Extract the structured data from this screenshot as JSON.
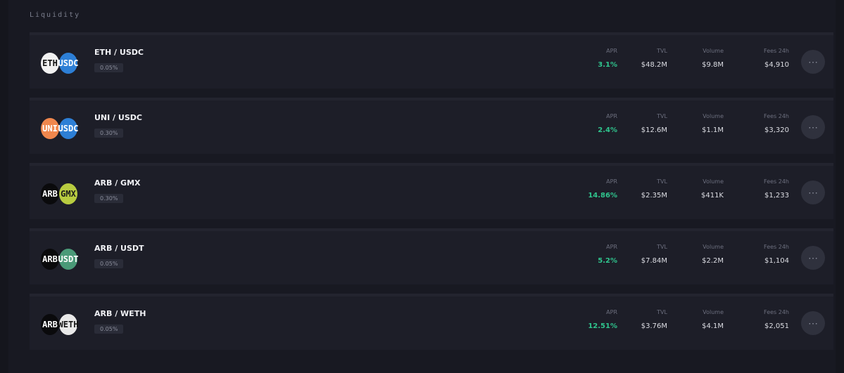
{
  "section": {
    "title": "Liquidity"
  },
  "pools": [
    {
      "name": "ETH / USDC",
      "badge": "0.05%",
      "token_a": {
        "symbol": "ETH",
        "icon": "eth-icon",
        "color": "#f2f2f2",
        "text": "#141414"
      },
      "token_b": {
        "symbol": "USDC",
        "icon": "usdc-icon",
        "color": "#2d7fd6",
        "text": "#ffffff"
      },
      "apr": {
        "label": "APR",
        "value": "3.1%"
      },
      "tvl": {
        "label": "TVL",
        "value": "$48.2M"
      },
      "volume": {
        "label": "Volume",
        "value": "$9.8M"
      },
      "fees": {
        "label": "Fees 24h",
        "value": "$4,910"
      }
    },
    {
      "name": "UNI / USDC",
      "badge": "0.30%",
      "token_a": {
        "symbol": "UNI",
        "icon": "uni-icon",
        "color": "#f0874d",
        "text": "#ffffff"
      },
      "token_b": {
        "symbol": "USDC",
        "icon": "usdc-icon",
        "color": "#2d7fd6",
        "text": "#ffffff"
      },
      "apr": {
        "label": "APR",
        "value": "2.4%"
      },
      "tvl": {
        "label": "TVL",
        "value": "$12.6M"
      },
      "volume": {
        "label": "Volume",
        "value": "$1.1M"
      },
      "fees": {
        "label": "Fees 24h",
        "value": "$3,320"
      }
    },
    {
      "name": "ARB / GMX",
      "badge": "0.30%",
      "token_a": {
        "symbol": "ARB",
        "icon": "arb-icon",
        "color": "#0a0a0c",
        "text": "#ffffff"
      },
      "token_b": {
        "symbol": "GMX",
        "icon": "gmx-icon",
        "color": "#b8cc40",
        "text": "#1a1a1a"
      },
      "apr": {
        "label": "APR",
        "value": "14.86%"
      },
      "tvl": {
        "label": "TVL",
        "value": "$2.35M"
      },
      "volume": {
        "label": "Volume",
        "value": "$411K"
      },
      "fees": {
        "label": "Fees 24h",
        "value": "$1,233"
      }
    },
    {
      "name": "ARB / USDT",
      "badge": "0.05%",
      "token_a": {
        "symbol": "ARB",
        "icon": "arb-icon",
        "color": "#0a0a0c",
        "text": "#ffffff"
      },
      "token_b": {
        "symbol": "USDT",
        "icon": "usdt-icon",
        "color": "#4a9a78",
        "text": "#ffffff"
      },
      "apr": {
        "label": "APR",
        "value": "5.2%"
      },
      "tvl": {
        "label": "TVL",
        "value": "$7.84M"
      },
      "volume": {
        "label": "Volume",
        "value": "$2.2M"
      },
      "fees": {
        "label": "Fees 24h",
        "value": "$1,104"
      }
    },
    {
      "name": "ARB / WETH",
      "badge": "0.05%",
      "token_a": {
        "symbol": "ARB",
        "icon": "arb-icon",
        "color": "#0a0a0c",
        "text": "#ffffff"
      },
      "token_b": {
        "symbol": "WETH",
        "icon": "weth-icon",
        "color": "#e9e9e9",
        "text": "#141414"
      },
      "apr": {
        "label": "APR",
        "value": "12.51%"
      },
      "tvl": {
        "label": "TVL",
        "value": "$3.76M"
      },
      "volume": {
        "label": "Volume",
        "value": "$4.1M"
      },
      "fees": {
        "label": "Fees 24h",
        "value": "$2,051"
      }
    }
  ],
  "action_icon": "more-icon",
  "action_glyph": "⋯"
}
